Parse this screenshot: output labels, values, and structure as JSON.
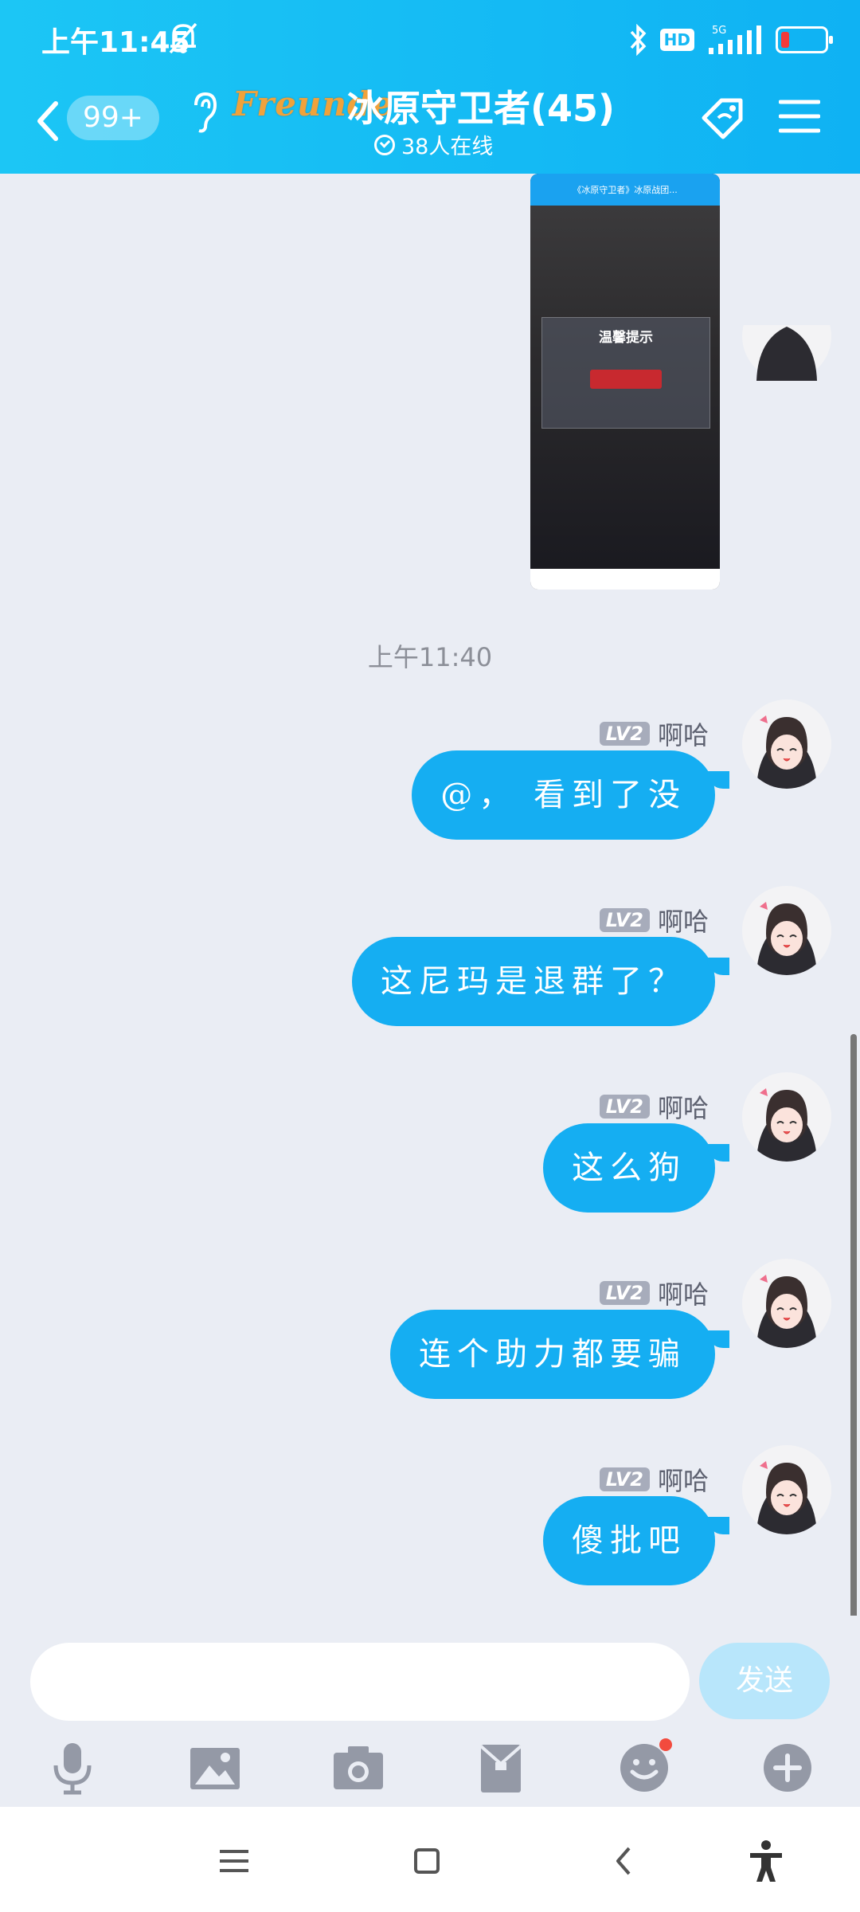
{
  "status": {
    "time": "上午11:45",
    "hd": "HD",
    "network": "5G"
  },
  "header": {
    "unread_count": "99+",
    "logo_text": "Freunde",
    "group_title": "冰原守卫者(45)",
    "online_text": "38人在线"
  },
  "shared_image": {
    "top_title": "《冰原守卫者》冰原战团...",
    "dialog_title": "温馨提示"
  },
  "timestamp": "上午11:40",
  "messages": [
    {
      "level": "LV2",
      "sender": "啊哈",
      "text": "@， 看到了没"
    },
    {
      "level": "LV2",
      "sender": "啊哈",
      "text": "这尼玛是退群了？"
    },
    {
      "level": "LV2",
      "sender": "啊哈",
      "text": "这么狗"
    },
    {
      "level": "LV2",
      "sender": "啊哈",
      "text": "连个助力都要骗"
    },
    {
      "level": "LV2",
      "sender": "啊哈",
      "text": "傻批吧"
    }
  ],
  "input": {
    "placeholder": "",
    "send_label": "发送"
  },
  "toolbar_icons": [
    "microphone-icon",
    "image-icon",
    "camera-icon",
    "red-packet-icon",
    "emoji-icon",
    "plus-icon"
  ],
  "colors": {
    "header": "#14b9f4",
    "bubble": "#15aef2",
    "background": "#eaedf4",
    "send_disabled": "#b8e6fb"
  }
}
